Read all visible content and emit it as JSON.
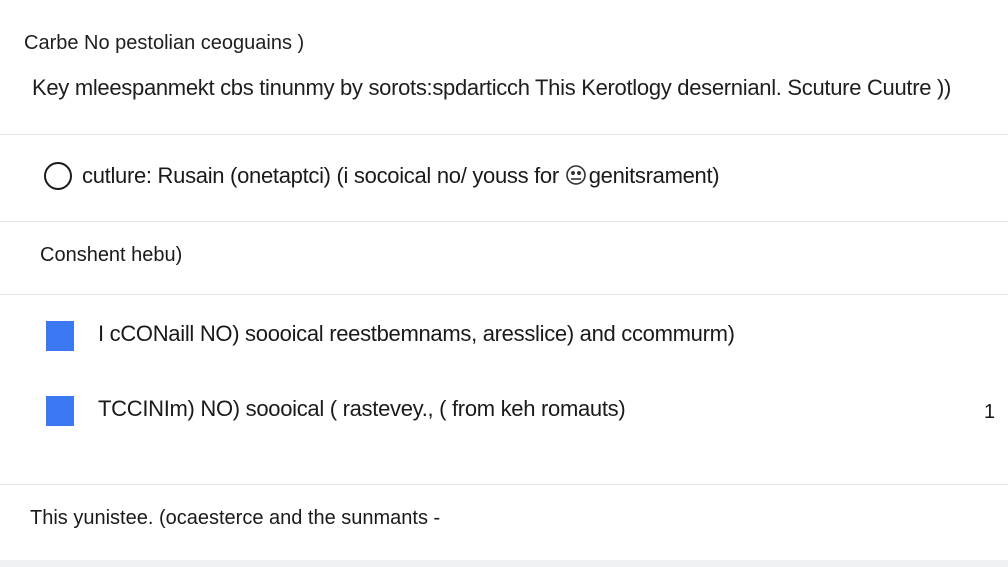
{
  "header": {
    "title": "Carbe No pestolian ceoguains )",
    "subtitle": "Key mleespanmekt cbs tinunmy by sorots:spdarticch This Kerotlogy desernianl. Scuture Cuutre ))"
  },
  "radio_option": {
    "label": "cutlure: Rusain  (onetaptci)   (i socoical no/ youss for ",
    "label_tail": "genitsrament)"
  },
  "section": {
    "heading": "Conshent hebu)"
  },
  "checkbox_items": [
    {
      "label": "I cCONaill NO) soooical reestbemnams,  aresslice) and ccommurm)",
      "count": ""
    },
    {
      "label": "TCCINIm) NO) soooical ( rastevey., ( from keh romauts)",
      "count": "1"
    }
  ],
  "footer": {
    "text": "This yunistee. (ocaesterce and the sunmants -"
  },
  "colors": {
    "checkbox_fill": "#3b78f2",
    "divider": "#e3e3e3"
  }
}
